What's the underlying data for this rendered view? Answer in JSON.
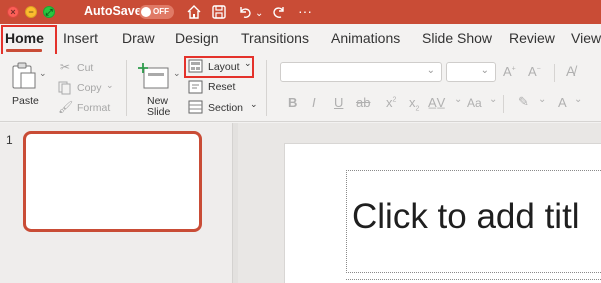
{
  "titlebar": {
    "autosave_label": "AutoSave",
    "autosave_state": "OFF",
    "more": "···"
  },
  "tabs": [
    "Home",
    "Insert",
    "Draw",
    "Design",
    "Transitions",
    "Animations",
    "Slide Show",
    "Review",
    "View"
  ],
  "ribbon": {
    "paste": "Paste",
    "cut": "Cut",
    "copy": "Copy",
    "format": "Format",
    "new_slide_line1": "New",
    "new_slide_line2": "Slide",
    "layout": "Layout",
    "reset": "Reset",
    "section": "Section"
  },
  "slides": {
    "number": "1",
    "title_placeholder": "Click to add titl"
  },
  "colors": {
    "brand": "#c94c36",
    "highlight": "#e4322b"
  }
}
